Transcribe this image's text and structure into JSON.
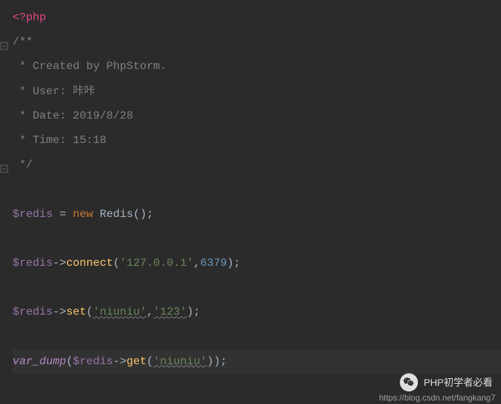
{
  "code": {
    "php_open": "<?php",
    "docblock_open": "/**",
    "doc_created": " * Created by PhpStorm.",
    "doc_user_label": " * User: ",
    "doc_user_value": "咔咔",
    "doc_date_label": " * Date: ",
    "doc_date_value": "2019/8/28",
    "doc_time_label": " * Time: ",
    "doc_time_value": "15:18",
    "docblock_close": " */",
    "var_redis": "$redis",
    "assign": " = ",
    "kw_new": "new",
    "class_redis": " Redis",
    "paren_open": "(",
    "paren_close": ")",
    "semicolon": ";",
    "arrow": "->",
    "method_connect": "connect",
    "str_host": "'127.0.0.1'",
    "comma": ",",
    "num_port": "6379",
    "method_set": "set",
    "str_key": "'niuniu'",
    "str_val": "'123'",
    "method_get": "get",
    "func_vardump": "var_dump"
  },
  "watermark": {
    "text": "PHP初学者必看",
    "url": "https://blog.csdn.net/fangkang7"
  }
}
